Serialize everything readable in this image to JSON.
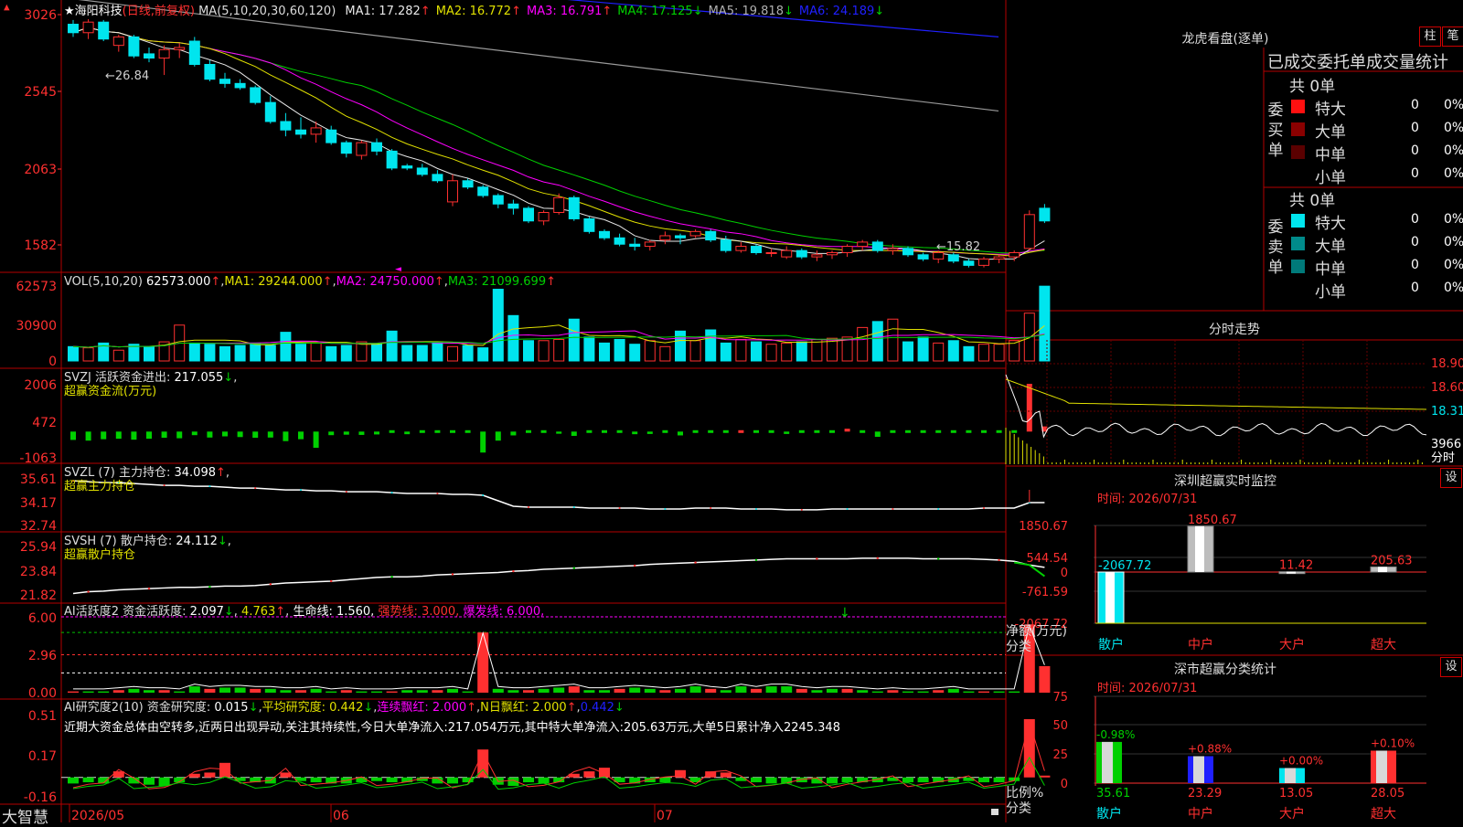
{
  "colors": {
    "up": "#ff3030",
    "down": "#00e5ee",
    "frame": "#b40000",
    "white": "#e8e8e8",
    "yellow": "#e0e000",
    "magenta": "#ff00ff",
    "green": "#00d000",
    "gray": "#9a9a9a",
    "blue": "#2020ff",
    "purple": "#a000a0"
  },
  "header": {
    "star": "★",
    "stock": "海阳科技",
    "mode": "(日线,前复权)",
    "ma_params": "MA(5,10,20,30,60,120)",
    "ma_values": [
      {
        "label": "MA1:",
        "value": "17.282",
        "arrow": "↑",
        "color": "#e8e8e8"
      },
      {
        "label": "MA2:",
        "value": "16.772",
        "arrow": "↑",
        "color": "#e0e000"
      },
      {
        "label": "MA3:",
        "value": "16.791",
        "arrow": "↑",
        "color": "#ff00ff"
      },
      {
        "label": "MA4:",
        "value": "17.125",
        "arrow": "↓",
        "color": "#00d000"
      },
      {
        "label": "MA5:",
        "value": "19.818",
        "arrow": "↓",
        "color": "#b0b0b0"
      },
      {
        "label": "MA6:",
        "value": "24.189",
        "arrow": "↓",
        "color": "#2020ff"
      }
    ]
  },
  "price_axis": {
    "ticks": [
      "3026",
      "2545",
      "2063",
      "1582"
    ]
  },
  "price_annotations": {
    "high": "←26.84",
    "low": "←15.82"
  },
  "vol": {
    "header": "VOL(5,10,20)",
    "value": "62573.000",
    "ma1": "MA1: 29244.000",
    "ma2": "MA2: 24750.000",
    "ma3": "MA3: 21099.699",
    "ticks": [
      "62573",
      "30900",
      "0"
    ]
  },
  "svzj": {
    "l1_name": "SVZJ  活跃资金进出:",
    "l1_value": "217.055",
    "l2": "超赢资金流(万元)",
    "ticks": [
      "2006",
      "472",
      "-1063"
    ]
  },
  "svzl": {
    "l1": "SVZL  (7) 主力持仓:",
    "value": "34.098",
    "l2": "超赢主力持仓",
    "ticks": [
      "35.61",
      "34.17",
      "32.74"
    ]
  },
  "svsh": {
    "l1": "SVSH  (7) 散户持仓:",
    "value": "24.112",
    "l2": "超赢散户持仓",
    "ticks": [
      "25.94",
      "23.84",
      "21.82"
    ]
  },
  "ai1": {
    "l1": "AI活跃度2 资金活跃度:",
    "v1": "2.097",
    "v2": "4.763",
    "v3": "生命线: 1.560,",
    "v4": "强势线: 3.000,",
    "v5": "爆发线: 6.000,",
    "ticks": [
      "6.00",
      "2.96",
      "0.00"
    ]
  },
  "ai2": {
    "l1": "AI研究度2(10) 资金研究度:",
    "v1": "0.015",
    "v2": "平均研究度: 0.442",
    "v3": "连续飘红: 2.000",
    "v4": "N日飘红: 2.000",
    "v5": "0.442",
    "desc": "近期大资金总体由空转多,近两日出现异动,关注其持续性,今日大单净流入:217.054万元,其中特大单净流入:205.63万元,大单5日累计净入2245.348",
    "ticks": [
      "0.51",
      "0.17",
      "-0.16"
    ]
  },
  "date_axis": {
    "labels": [
      "2026/05",
      "06",
      "07"
    ],
    "brand": "大智慧"
  },
  "lhb": {
    "title": "龙虎看盘(逐单)",
    "btn1": "柱",
    "btn2": "笔",
    "subtitle": "已成交委托单成交量统计",
    "buy": {
      "side": "委买单",
      "total": "共 0单",
      "rows": [
        {
          "name": "特大",
          "count": "0",
          "pct": "0%",
          "color": "#ff1010"
        },
        {
          "name": "大单",
          "count": "0",
          "pct": "0%",
          "color": "#8a0000"
        },
        {
          "name": "中单",
          "count": "0",
          "pct": "0%",
          "color": "#5a0000"
        },
        {
          "name": "小单",
          "count": "0",
          "pct": "0%",
          "color": ""
        }
      ]
    },
    "sell": {
      "side": "委卖单",
      "total": "共 0单",
      "rows": [
        {
          "name": "特大",
          "count": "0",
          "pct": "0%",
          "color": "#00e5ee"
        },
        {
          "name": "大单",
          "count": "0",
          "pct": "0%",
          "color": "#008a8a"
        },
        {
          "name": "中单",
          "count": "0",
          "pct": "0%",
          "color": "#007a7a"
        },
        {
          "name": "小单",
          "count": "0",
          "pct": "0%",
          "color": ""
        }
      ]
    }
  },
  "intraday": {
    "title": "分时走势",
    "prices": [
      "18.90",
      "18.60",
      "18.31"
    ],
    "vol": "3966",
    "vol_label": "分时"
  },
  "monitor": {
    "title": "深圳超赢实时监控",
    "btn": "设",
    "time": "时间: 2026/07/31",
    "ticks": [
      "1850.67",
      "544.54",
      "0",
      "-761.59",
      "-2067.72"
    ],
    "ylabel": "净额(万元)",
    "xlabel": "分类",
    "cats": [
      "散户",
      "中户",
      "大户",
      "超大"
    ],
    "values": [
      -2067.72,
      1850.67,
      11.42,
      205.63
    ],
    "value_labels": [
      "-2067.72",
      "1850.67",
      "11.42",
      "205.63"
    ]
  },
  "classify": {
    "title": "深市超赢分类统计",
    "btn": "设",
    "time": "时间: 2026/07/31",
    "ticks": [
      "75",
      "50",
      "25",
      "0"
    ],
    "ylabel": "比例%",
    "xlabel": "分类",
    "cats": [
      "散户",
      "中户",
      "大户",
      "超大"
    ],
    "values": [
      35.61,
      23.29,
      13.05,
      28.05
    ],
    "value_labels": [
      "35.61",
      "23.29",
      "13.05",
      "28.05"
    ],
    "changes": [
      "-0.98%",
      "+0.88%",
      "+0.00%",
      "+0.10%"
    ]
  },
  "chart_data": [
    {
      "type": "candlestick",
      "title": "海阳科技 (日线,前复权)",
      "ohlc": [
        [
          26.6,
          26.8,
          26.0,
          26.2
        ],
        [
          26.2,
          26.84,
          25.9,
          26.7
        ],
        [
          26.7,
          26.8,
          25.8,
          25.9
        ],
        [
          25.6,
          26.1,
          25.3,
          26.0
        ],
        [
          26.0,
          26.1,
          25.0,
          25.1
        ],
        [
          25.2,
          25.5,
          24.8,
          25.0
        ],
        [
          25.0,
          25.6,
          24.2,
          25.4
        ],
        [
          25.4,
          25.7,
          25.0,
          25.5
        ],
        [
          25.8,
          26.0,
          24.6,
          24.7
        ],
        [
          24.7,
          24.9,
          23.9,
          24.0
        ],
        [
          24.0,
          24.3,
          23.6,
          23.8
        ],
        [
          23.8,
          24.0,
          23.5,
          23.6
        ],
        [
          23.6,
          23.7,
          22.8,
          22.9
        ],
        [
          22.9,
          23.2,
          21.9,
          22.0
        ],
        [
          22.0,
          22.4,
          21.3,
          21.6
        ],
        [
          21.6,
          22.2,
          21.2,
          21.4
        ],
        [
          21.4,
          22.0,
          21.0,
          21.7
        ],
        [
          21.6,
          21.8,
          20.9,
          21.0
        ],
        [
          21.0,
          21.1,
          20.3,
          20.5
        ],
        [
          20.4,
          21.1,
          20.2,
          21.0
        ],
        [
          21.0,
          21.2,
          20.4,
          20.6
        ],
        [
          20.6,
          20.7,
          19.7,
          19.8
        ],
        [
          19.9,
          20.0,
          19.7,
          19.8
        ],
        [
          19.8,
          20.0,
          19.4,
          19.5
        ],
        [
          19.5,
          19.7,
          19.1,
          19.2
        ],
        [
          18.2,
          19.5,
          18.0,
          19.2
        ],
        [
          19.2,
          19.3,
          18.8,
          18.9
        ],
        [
          18.9,
          19.0,
          18.4,
          18.5
        ],
        [
          18.5,
          18.6,
          17.9,
          18.1
        ],
        [
          18.1,
          18.3,
          17.6,
          17.9
        ],
        [
          17.9,
          18.0,
          17.2,
          17.3
        ],
        [
          17.3,
          17.8,
          17.1,
          17.7
        ],
        [
          17.7,
          18.6,
          17.6,
          18.4
        ],
        [
          18.4,
          18.5,
          17.3,
          17.4
        ],
        [
          17.4,
          17.5,
          16.7,
          16.8
        ],
        [
          16.8,
          16.9,
          16.4,
          16.5
        ],
        [
          16.5,
          16.7,
          16.1,
          16.2
        ],
        [
          16.2,
          16.5,
          15.9,
          16.1
        ],
        [
          16.1,
          16.4,
          15.9,
          16.3
        ],
        [
          16.4,
          16.8,
          16.2,
          16.6
        ],
        [
          16.6,
          16.7,
          16.2,
          16.5
        ],
        [
          16.6,
          16.9,
          16.5,
          16.8
        ],
        [
          16.8,
          16.9,
          16.3,
          16.4
        ],
        [
          16.4,
          16.6,
          15.8,
          15.9
        ],
        [
          15.9,
          16.3,
          15.8,
          16.1
        ],
        [
          16.1,
          16.2,
          15.7,
          15.8
        ],
        [
          15.8,
          16.0,
          15.6,
          15.8
        ],
        [
          15.6,
          16.1,
          15.5,
          15.9
        ],
        [
          15.9,
          16.0,
          15.5,
          15.6
        ],
        [
          15.6,
          15.9,
          15.4,
          15.7
        ],
        [
          15.7,
          15.9,
          15.5,
          15.8
        ],
        [
          15.8,
          16.2,
          15.6,
          16.1
        ],
        [
          16.1,
          16.4,
          15.9,
          16.3
        ],
        [
          16.3,
          16.4,
          15.8,
          15.9
        ],
        [
          15.9,
          16.2,
          15.7,
          16.0
        ],
        [
          16.0,
          16.1,
          15.6,
          15.7
        ],
        [
          15.7,
          15.8,
          15.4,
          15.5
        ],
        [
          15.5,
          15.9,
          15.3,
          15.8
        ],
        [
          15.7,
          15.8,
          15.3,
          15.4
        ],
        [
          15.4,
          15.5,
          15.1,
          15.2
        ],
        [
          15.2,
          15.6,
          15.1,
          15.5
        ],
        [
          15.5,
          15.7,
          15.3,
          15.6
        ],
        [
          15.6,
          15.9,
          15.4,
          15.8
        ],
        [
          16.0,
          17.8,
          15.9,
          17.6
        ],
        [
          17.9,
          18.1,
          17.2,
          17.3
        ]
      ],
      "ylim": [
        15.0,
        27.4
      ],
      "yticks": [
        "3026",
        "2545",
        "2063",
        "1582"
      ],
      "ma_series": [
        {
          "name": "MA1",
          "color": "#e8e8e8"
        },
        {
          "name": "MA2",
          "color": "#e0e000"
        },
        {
          "name": "MA3",
          "color": "#ff00ff"
        },
        {
          "name": "MA4",
          "color": "#00d000"
        },
        {
          "name": "MA5",
          "color": "#9a9a9a",
          "values": [
            27.8,
            22.5
          ]
        },
        {
          "name": "MA6",
          "color": "#2020ff",
          "values": [
            29.8,
            26.0
          ]
        }
      ]
    },
    {
      "type": "bar",
      "title": "VOL(5,10,20)",
      "values": [
        12000,
        11000,
        15000,
        9000,
        14000,
        12000,
        16000,
        30000,
        15000,
        14000,
        12000,
        13000,
        15000,
        13000,
        24000,
        14000,
        15000,
        12000,
        13000,
        16000,
        14000,
        25000,
        13000,
        13000,
        16000,
        12000,
        13000,
        11000,
        60000,
        38000,
        17000,
        17000,
        18000,
        35000,
        20000,
        15000,
        18000,
        14000,
        17000,
        12000,
        25000,
        17000,
        26000,
        15000,
        18000,
        16000,
        14000,
        15000,
        16000,
        18000,
        19000,
        20000,
        28000,
        33000,
        35000,
        16000,
        20000,
        15000,
        17000,
        12000,
        14000,
        14000,
        17000,
        40000,
        62573
      ],
      "ylim": [
        0,
        65000
      ]
    },
    {
      "type": "bar",
      "title": "SVZJ 活跃资金进出",
      "values": [
        -350,
        -380,
        -320,
        -300,
        -340,
        -300,
        -260,
        -280,
        -150,
        -250,
        -200,
        -230,
        -260,
        -250,
        -400,
        -320,
        -680,
        -150,
        -130,
        -140,
        -120,
        -80,
        -110,
        -60,
        -40,
        -60,
        -80,
        -880,
        -380,
        -160,
        -80,
        -60,
        -90,
        -180,
        -80,
        -60,
        -70,
        -110,
        -100,
        -80,
        -160,
        -80,
        -40,
        -60,
        40,
        -40,
        -20,
        -100,
        -20,
        -80,
        -40,
        120,
        -60,
        -220,
        -80,
        -40,
        -60,
        -80,
        -40,
        -60,
        -40,
        -20,
        -30,
        2006,
        217
      ],
      "ylim": [
        -1063,
        2006
      ]
    },
    {
      "type": "line",
      "title": "SVZL 主力持仓",
      "values": [
        35.3,
        35.25,
        35.2,
        35.2,
        35.15,
        35.1,
        35.05,
        35.05,
        35.0,
        35.0,
        34.95,
        34.9,
        34.9,
        34.85,
        34.8,
        34.8,
        34.75,
        34.75,
        34.7,
        34.7,
        34.7,
        34.65,
        34.6,
        34.6,
        34.6,
        34.55,
        34.55,
        34.5,
        34.2,
        33.9,
        33.85,
        33.85,
        33.85,
        33.85,
        33.8,
        33.8,
        33.8,
        33.8,
        33.75,
        33.75,
        33.75,
        33.8,
        33.8,
        33.8,
        33.75,
        33.75,
        33.75,
        33.7,
        33.7,
        33.7,
        33.75,
        33.75,
        33.75,
        33.75,
        33.75,
        33.75,
        33.75,
        33.75,
        33.75,
        33.75,
        33.8,
        33.8,
        33.8,
        34.1,
        34.1
      ],
      "ylim": [
        32.74,
        35.61
      ]
    },
    {
      "type": "line",
      "title": "SVSH 散户持仓",
      "values": [
        22.0,
        22.15,
        22.2,
        22.3,
        22.35,
        22.4,
        22.45,
        22.5,
        22.5,
        22.55,
        22.6,
        22.6,
        22.65,
        22.75,
        22.85,
        22.9,
        22.95,
        23.0,
        23.1,
        23.2,
        23.3,
        23.35,
        23.35,
        23.4,
        23.5,
        23.55,
        23.6,
        23.65,
        23.7,
        23.8,
        23.85,
        23.95,
        24.0,
        24.05,
        24.1,
        24.15,
        24.2,
        24.25,
        24.35,
        24.4,
        24.45,
        24.5,
        24.55,
        24.6,
        24.65,
        24.7,
        24.75,
        24.8,
        24.8,
        24.8,
        24.8,
        24.8,
        24.85,
        24.85,
        24.85,
        24.85,
        24.8,
        24.8,
        24.8,
        24.8,
        24.75,
        24.7,
        24.6,
        24.3,
        24.11
      ],
      "ylim": [
        21.82,
        25.94
      ]
    },
    {
      "type": "bar",
      "title": "AI活跃度2 资金活跃度",
      "values": [
        0.1,
        0.1,
        0.1,
        0.2,
        0.3,
        0.2,
        0.2,
        0.1,
        0.5,
        0.3,
        0.4,
        0.4,
        0.3,
        0.3,
        0.2,
        0.2,
        0.3,
        0.1,
        0.2,
        0.1,
        0.1,
        0.1,
        0.2,
        0.2,
        0.2,
        0.3,
        0.1,
        4.763,
        0.3,
        0.2,
        0.2,
        0.3,
        0.4,
        0.5,
        0.2,
        0.2,
        0.3,
        0.4,
        0.3,
        0.2,
        0.3,
        0.5,
        0.3,
        0.2,
        0.5,
        0.3,
        0.5,
        0.5,
        0.3,
        0.2,
        0.3,
        0.3,
        0.2,
        0.1,
        0.2,
        0.1,
        0.1,
        0.2,
        0.3,
        0.1,
        0.1,
        0.1,
        0.1,
        5.4,
        2.097
      ],
      "ylim": [
        0,
        6.0
      ]
    },
    {
      "type": "bar",
      "title": "AI研究度2(10) 资金研究度",
      "values": [
        -0.05,
        -0.04,
        -0.05,
        0.05,
        -0.05,
        -0.06,
        -0.07,
        -0.04,
        0.03,
        0.04,
        0.12,
        -0.03,
        -0.04,
        -0.05,
        0.04,
        -0.03,
        -0.04,
        -0.05,
        -0.05,
        -0.04,
        -0.03,
        -0.04,
        -0.04,
        -0.03,
        -0.05,
        -0.05,
        -0.04,
        0.23,
        -0.06,
        -0.07,
        -0.04,
        -0.05,
        -0.04,
        0.03,
        0.05,
        0.08,
        -0.04,
        -0.05,
        -0.04,
        -0.04,
        0.06,
        -0.04,
        0.05,
        0.04,
        -0.03,
        -0.04,
        -0.05,
        -0.05,
        -0.04,
        -0.05,
        -0.05,
        -0.04,
        -0.04,
        -0.04,
        -0.03,
        -0.04,
        -0.04,
        -0.04,
        -0.04,
        -0.03,
        -0.04,
        -0.04,
        -0.03,
        0.48,
        0.015
      ],
      "ylim": [
        -0.16,
        0.51
      ]
    }
  ]
}
